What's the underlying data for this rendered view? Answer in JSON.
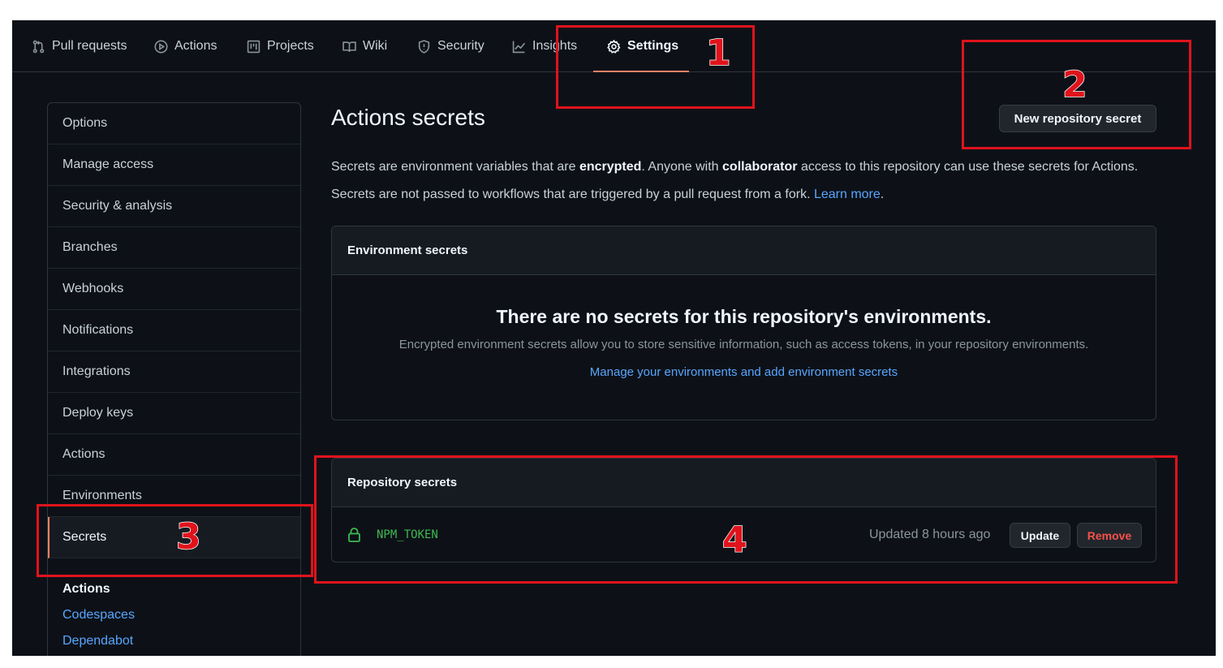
{
  "nav": {
    "tabs": [
      {
        "label": "Pull requests",
        "icon": "pull-request-icon"
      },
      {
        "label": "Actions",
        "icon": "play-icon"
      },
      {
        "label": "Projects",
        "icon": "project-board-icon"
      },
      {
        "label": "Wiki",
        "icon": "book-icon"
      },
      {
        "label": "Security",
        "icon": "shield-icon"
      },
      {
        "label": "Insights",
        "icon": "graph-icon"
      },
      {
        "label": "Settings",
        "icon": "gear-icon",
        "active": true
      }
    ]
  },
  "sidebar": {
    "items": [
      {
        "label": "Options"
      },
      {
        "label": "Manage access"
      },
      {
        "label": "Security & analysis"
      },
      {
        "label": "Branches"
      },
      {
        "label": "Webhooks"
      },
      {
        "label": "Notifications"
      },
      {
        "label": "Integrations"
      },
      {
        "label": "Deploy keys"
      },
      {
        "label": "Actions"
      },
      {
        "label": "Environments"
      },
      {
        "label": "Secrets",
        "selected": true
      }
    ],
    "sub_title": "Actions",
    "sub_links": [
      {
        "label": "Codespaces"
      },
      {
        "label": "Dependabot"
      }
    ]
  },
  "main": {
    "title": "Actions secrets",
    "new_button": "New repository secret",
    "desc1": {
      "p1": "Secrets are environment variables that are ",
      "b1": "encrypted",
      "p2": ". Anyone with ",
      "b2": "collaborator",
      "p3": " access to this repository can use these secrets for Actions."
    },
    "desc2": {
      "text": "Secrets are not passed to workflows that are triggered by a pull request from a fork. ",
      "link": "Learn more",
      "end": "."
    },
    "env_box": {
      "heading": "Environment secrets",
      "blank_title": "There are no secrets for this repository's environments.",
      "blank_desc": "Encrypted environment secrets allow you to store sensitive information, such as access tokens, in your repository environments.",
      "blank_link": "Manage your environments and add environment secrets"
    },
    "repo_box": {
      "heading": "Repository secrets",
      "secrets": [
        {
          "name": "NPM_TOKEN",
          "updated": "Updated 8 hours ago",
          "update_label": "Update",
          "remove_label": "Remove"
        }
      ]
    }
  },
  "annotations": {
    "labels": [
      "1",
      "2",
      "3",
      "4"
    ],
    "color": "#e0131c"
  }
}
